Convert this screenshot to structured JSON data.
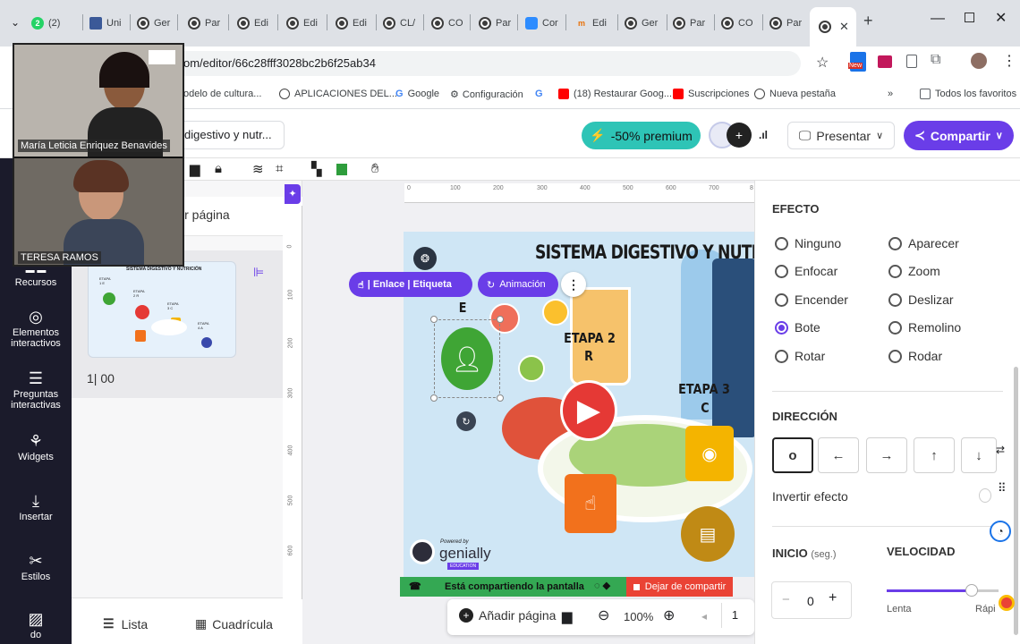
{
  "browser": {
    "tabs": [
      {
        "label": "(2)",
        "badge": "2"
      },
      {
        "label": "Uni"
      },
      {
        "label": "Ger"
      },
      {
        "label": "Par"
      },
      {
        "label": "Edi"
      },
      {
        "label": "Edi"
      },
      {
        "label": "Edi"
      },
      {
        "label": "CL/"
      },
      {
        "label": "CO"
      },
      {
        "label": "Par"
      },
      {
        "label": "Cor"
      },
      {
        "label": "Edi"
      },
      {
        "label": "Ger"
      },
      {
        "label": "Par"
      },
      {
        "label": "CO"
      },
      {
        "label": "Par"
      }
    ],
    "url": "om/editor/66c28fff3028bc2b6f25ab34",
    "bookmarks": [
      "odelo de cultura...",
      "APLICACIONES DEL...",
      "Google",
      "Configuración",
      "(18) Restaurar Goog...",
      "Suscripciones",
      "Nueva pestaña"
    ],
    "all_bookmarks": "Todos los favoritos",
    "new_badge": "New",
    "more_bookmarks": "»"
  },
  "video": {
    "participant1": "María Leticia Enriquez Benavides",
    "participant2": "TERESA RAMOS"
  },
  "header": {
    "project_name": "digestivo y nutr...",
    "premium_label": "-50% premium",
    "present_label": "Presentar",
    "share_label": "Compartir"
  },
  "rail": {
    "items": [
      "Recursos",
      "Elementos interactivos",
      "Preguntas interactivas",
      "Widgets",
      "Insertar",
      "Estilos",
      "do"
    ]
  },
  "pages_panel": {
    "add_page": "ir página",
    "page_label": "1| 00",
    "thumb_title": "SISTEMA DIGESTIVO Y NUTRICIÓN",
    "thumb_etapas": [
      "ETAPA 1 E",
      "ETAPA 2 R",
      "ETAPA 3 C",
      "ETAPA 4 A"
    ],
    "list_label": "Lista",
    "grid_label": "Cuadrícula"
  },
  "canvas": {
    "ruler_ticks": [
      "0",
      "100",
      "200",
      "300",
      "400",
      "500",
      "600",
      "700",
      "8"
    ],
    "vruler_ticks": [
      "0",
      "100",
      "200",
      "300",
      "400",
      "500",
      "600"
    ],
    "slide_title": "SISTEMA DIGESTIVO Y NUTR",
    "etapa1_letter": "E",
    "etapa2": "ETAPA 2",
    "etapa2_letter": "R",
    "etapa3": "ETAPA 3",
    "etapa3_letter": "C",
    "context_link": "| Enlace | Etiqueta",
    "context_anim": "Animación",
    "powered_by": "Powered by",
    "genially": "genially",
    "education": "EDUCATION",
    "sharing": "Está compartiendo la pantalla",
    "stop_sharing": "Dejar de compartir",
    "add_page": "Añadir página",
    "zoom": "100%",
    "page_num": "1"
  },
  "effect_panel": {
    "effect_title": "EFECTO",
    "effects_left": [
      "Ninguno",
      "Enfocar",
      "Encender",
      "Bote",
      "Rotar"
    ],
    "effects_right": [
      "Aparecer",
      "Zoom",
      "Deslizar",
      "Remolino",
      "Rodar"
    ],
    "selected_effect": "Bote",
    "direction_title": "DIRECCIÓN",
    "direction_buttons": [
      "o",
      "←",
      "→",
      "↑",
      "↓"
    ],
    "invert_label": "Invertir efecto",
    "start_title": "INICIO",
    "start_unit": "(seg.)",
    "start_value": "0",
    "speed_title": "VELOCIDAD",
    "speed_min": "Lenta",
    "speed_max": "Rápi"
  },
  "colors": {
    "accent": "#6a3de8",
    "premium": "#2ec4b6",
    "rail_bg": "#1b1b2b",
    "share_green": "#34a853",
    "stop_red": "#ea4335"
  }
}
